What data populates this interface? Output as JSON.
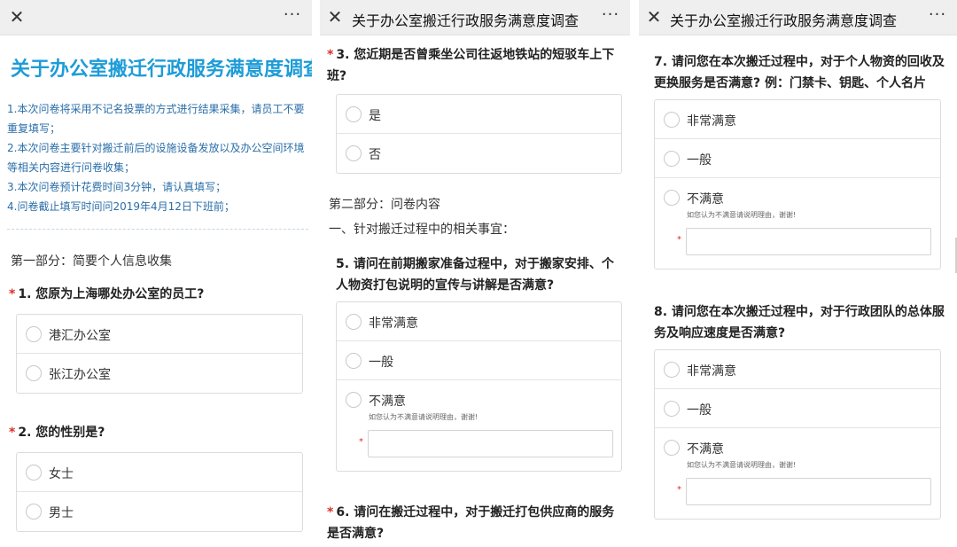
{
  "panel1": {
    "survey_title": "关于办公室搬迁行政服务满意度调查",
    "intro": [
      "1.本次问卷将采用不记名投票的方式进行结果采集，请员工不要重复填写；",
      "2.本次问卷主要针对搬迁前后的设施设备发放以及办公空间环境等相关内容进行问卷收集；",
      "3.本次问卷预计花费时间3分钟，请认真填写；",
      "4.问卷截止填写时间问2019年4月12日下班前；"
    ],
    "part1": "第一部分：简要个人信息收集",
    "q1": {
      "required": "*",
      "text": "1. 您原为上海哪处办公室的员工?",
      "options": [
        "港汇办公室",
        "张江办公室"
      ]
    },
    "q2": {
      "required": "*",
      "text": "2. 您的性别是?",
      "options": [
        "女士",
        "男士"
      ]
    }
  },
  "panel2": {
    "title": "关于办公室搬迁行政服务满意度调查",
    "q3": {
      "required": "*",
      "text": "3. 您近期是否曾乘坐公司往返地铁站的短驳车上下班?",
      "options": [
        "是",
        "否"
      ]
    },
    "part2": "第二部分：问卷内容",
    "section1": "一、针对搬迁过程中的相关事宜：",
    "q5": {
      "text": "5. 请问在前期搬家准备过程中，对于搬家安排、个人物资打包说明的宣传与讲解是否满意?",
      "options": [
        "非常满意",
        "一般",
        "不满意"
      ],
      "hint": "如您认为不满意请说明理由，谢谢!",
      "reason_required": "*"
    },
    "q6": {
      "required": "*",
      "text": "6. 请问在搬迁过程中，对于搬迁打包供应商的服务是否满意?"
    }
  },
  "panel3": {
    "title": "关于办公室搬迁行政服务满意度调查",
    "q7": {
      "text": "7. 请问您在本次搬迁过程中，对于个人物资的回收及更换服务是否满意? 例：门禁卡、钥匙、个人名片",
      "options": [
        "非常满意",
        "一般",
        "不满意"
      ],
      "hint": "如您认为不满意请说明理由，谢谢!",
      "reason_required": "*"
    },
    "q8": {
      "text": "8. 请问您在本次搬迁过程中，对于行政团队的总体服务及响应速度是否满意?",
      "options": [
        "非常满意",
        "一般",
        "不满意"
      ],
      "hint": "如您认为不满意请说明理由，谢谢!",
      "reason_required": "*"
    }
  },
  "icons": {
    "close": "close-icon",
    "more": "more-icon",
    "radio": "radio-icon"
  },
  "colors": {
    "title_blue": "#1e9cd7",
    "intro_blue": "#2a6ea8",
    "required_red": "#d9302d"
  }
}
